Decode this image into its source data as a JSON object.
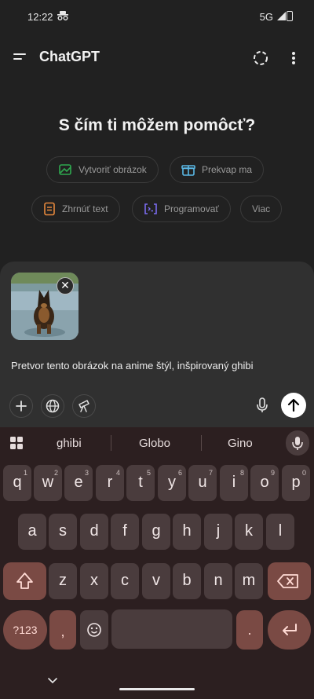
{
  "status_bar": {
    "time": "12:22",
    "network": "5G"
  },
  "header": {
    "title": "ChatGPT"
  },
  "main": {
    "heading": "S čím ti môžem pomôcť?",
    "chips": [
      {
        "label": "Vytvoriť obrázok",
        "icon": "image-icon",
        "color": "#2fa84f"
      },
      {
        "label": "Prekvap ma",
        "icon": "gift-icon",
        "color": "#5ab8e6"
      },
      {
        "label": "Zhrnúť text",
        "icon": "document-icon",
        "color": "#e6883c"
      },
      {
        "label": "Programovať",
        "icon": "code-icon",
        "color": "#7b6cf0"
      },
      {
        "label": "Viac"
      }
    ]
  },
  "composer": {
    "prompt_text": "Pretvor tento obrázok na anime štýl, inšpirovaný ghibi",
    "attachment": "dog-photo-thumbnail",
    "remove_symbol": "✕"
  },
  "keyboard": {
    "suggestions": [
      "ghibi",
      "Globo",
      "Gino"
    ],
    "row1": [
      {
        "k": "q",
        "n": "1"
      },
      {
        "k": "w",
        "n": "2"
      },
      {
        "k": "e",
        "n": "3"
      },
      {
        "k": "r",
        "n": "4"
      },
      {
        "k": "t",
        "n": "5"
      },
      {
        "k": "y",
        "n": "6"
      },
      {
        "k": "u",
        "n": "7"
      },
      {
        "k": "i",
        "n": "8"
      },
      {
        "k": "o",
        "n": "9"
      },
      {
        "k": "p",
        "n": "0"
      }
    ],
    "row2": [
      "a",
      "s",
      "d",
      "f",
      "g",
      "h",
      "j",
      "k",
      "l"
    ],
    "row3": [
      "z",
      "x",
      "c",
      "v",
      "b",
      "n",
      "m"
    ],
    "symbols_key": "?123",
    "comma_key": ",",
    "period_key": "."
  }
}
